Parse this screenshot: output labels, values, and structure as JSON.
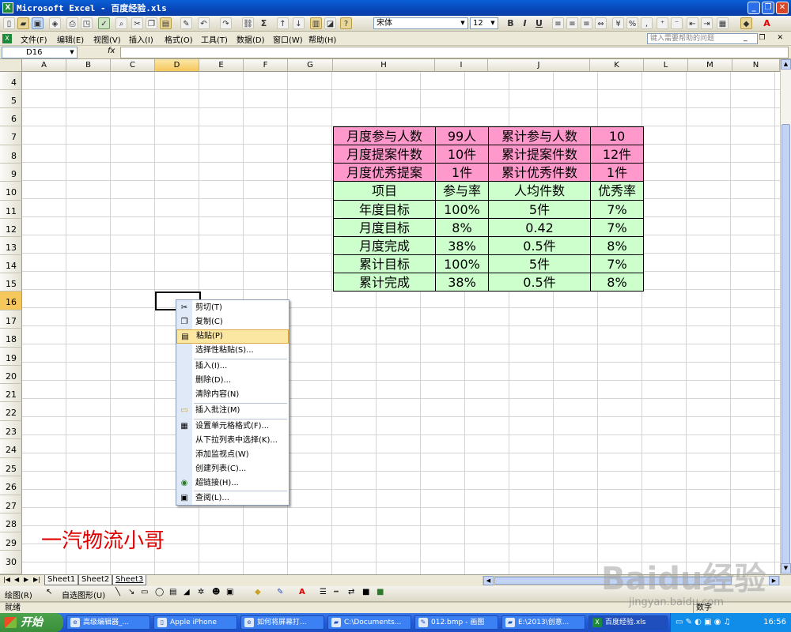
{
  "window": {
    "title": "Microsoft Excel - 百度经验.xls"
  },
  "toolbar": {
    "font_name": "宋体",
    "font_size": "12",
    "bold_label": "B",
    "italic_label": "I",
    "underline_label": "U",
    "sigma_label": "Σ"
  },
  "menubar": {
    "items": [
      "文件(F)",
      "编辑(E)",
      "视图(V)",
      "插入(I)",
      "格式(O)",
      "工具(T)",
      "数据(D)",
      "窗口(W)",
      "帮助(H)"
    ],
    "help_placeholder": "键入需要帮助的问题"
  },
  "formula_bar": {
    "name_box": "D16",
    "fx_label": "fx",
    "formula": ""
  },
  "grid": {
    "columns": [
      "A",
      "B",
      "C",
      "D",
      "E",
      "F",
      "G",
      "H",
      "I",
      "J",
      "K",
      "L",
      "M",
      "N"
    ],
    "active_column": "D",
    "rows": [
      "4",
      "5",
      "6",
      "7",
      "8",
      "9",
      "10",
      "11",
      "12",
      "13",
      "14",
      "15",
      "16",
      "17",
      "18",
      "19",
      "20",
      "21",
      "22",
      "23",
      "24",
      "25",
      "26",
      "27",
      "28",
      "29",
      "30"
    ],
    "active_row": "16"
  },
  "table": {
    "rows": [
      {
        "fill": "pink",
        "cells": [
          "月度参与人数",
          "99人",
          "累计参与人数",
          "10"
        ]
      },
      {
        "fill": "pink",
        "cells": [
          "月度提案件数",
          "10件",
          "累计提案件数",
          "12件"
        ]
      },
      {
        "fill": "pink",
        "cells": [
          "月度优秀提案",
          "1件",
          "累计优秀件数",
          "1件"
        ]
      },
      {
        "fill": "green",
        "cells": [
          "项目",
          "参与率",
          "人均件数",
          "优秀率"
        ]
      },
      {
        "fill": "green",
        "cells": [
          "年度目标",
          "100%",
          "5件",
          "7%"
        ]
      },
      {
        "fill": "green",
        "cells": [
          "月度目标",
          "8%",
          "0.42",
          "7%"
        ]
      },
      {
        "fill": "green",
        "cells": [
          "月度完成",
          "38%",
          "0.5件",
          "8%"
        ]
      },
      {
        "fill": "green",
        "cells": [
          "累计目标",
          "100%",
          "5件",
          "7%"
        ]
      },
      {
        "fill": "green",
        "cells": [
          "累计完成",
          "38%",
          "0.5件",
          "8%"
        ]
      }
    ],
    "colors": {
      "pink": "#ff99cc",
      "green": "#ccffcc"
    }
  },
  "sheet_text": {
    "red_text": "一汽物流小哥",
    "red_color": "#e00000"
  },
  "context_menu": {
    "items": [
      {
        "label": "剪切(T)",
        "icon": "scissors-icon",
        "glyph": "✂"
      },
      {
        "label": "复制(C)",
        "icon": "copy-icon",
        "glyph": "❐"
      },
      {
        "label": "粘贴(P)",
        "icon": "paste-icon",
        "glyph": "📋",
        "highlighted": true
      },
      {
        "label": "选择性粘贴(S)...",
        "icon": "",
        "glyph": ""
      },
      {
        "label": "插入(I)...",
        "icon": "",
        "glyph": ""
      },
      {
        "label": "删除(D)...",
        "icon": "",
        "glyph": ""
      },
      {
        "label": "清除内容(N)",
        "icon": "",
        "glyph": ""
      },
      {
        "label": "插入批注(M)",
        "icon": "comment-icon",
        "glyph": "▭"
      },
      {
        "label": "设置单元格格式(F)...",
        "icon": "format-cells-icon",
        "glyph": "▦"
      },
      {
        "label": "从下拉列表中选择(K)...",
        "icon": "",
        "glyph": ""
      },
      {
        "label": "添加监视点(W)",
        "icon": "",
        "glyph": ""
      },
      {
        "label": "创建列表(C)...",
        "icon": "",
        "glyph": ""
      },
      {
        "label": "超链接(H)...",
        "icon": "hyperlink-icon",
        "glyph": "🌐"
      },
      {
        "label": "查阅(L)...",
        "icon": "research-icon",
        "glyph": "📖"
      }
    ]
  },
  "sheet_tabs": [
    "Sheet1",
    "Sheet2",
    "Sheet3"
  ],
  "active_sheet": "Sheet3",
  "drawing_toolbar": {
    "draw_label": "绘图(R)",
    "autoshapes_label": "自选图形(U)"
  },
  "status_bar": {
    "left": "就绪",
    "right": "数字"
  },
  "taskbar": {
    "start_label": "开始",
    "tasks": [
      "高级编辑器_...",
      "Apple iPhone",
      "如何将屏幕打...",
      "C:\\Documents...",
      "012.bmp - 画图",
      "E:\\2013\\创意...",
      "百度经验.xls"
    ],
    "active_task": "百度经验.xls",
    "clock": "16:56"
  },
  "watermark": {
    "brand": "Baidu经验",
    "url": "jingyan.baidu.com"
  }
}
